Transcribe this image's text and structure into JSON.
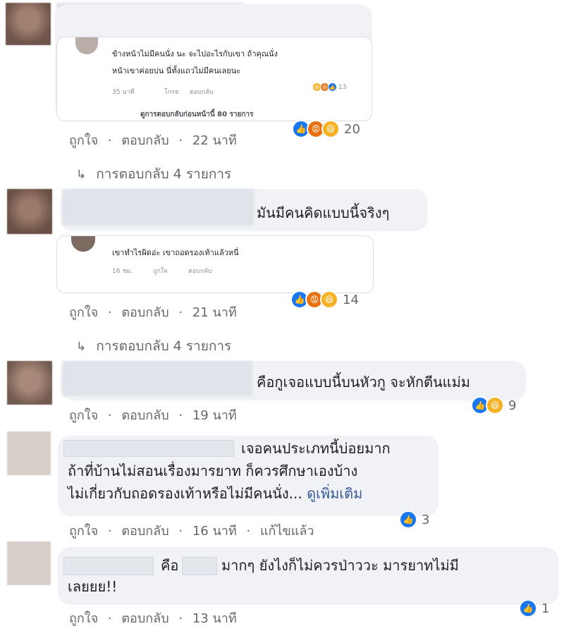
{
  "comments": [
    {
      "quoted": {
        "line1": "ข้างหน้าไม่มีคนนั่ง นะ จะไปอะไรกับเขา  ถ้าคุณนั่ง",
        "line2": "หน้าเขาค่อยบ่น นี่ทั้งแถวไม่มีคนเลยนะ",
        "meta_time": "35 นาที",
        "meta_like": "โกรธ",
        "meta_reply": "ตอบกลับ",
        "meta_count": "13",
        "more_replies": "ดูการตอบกลับก่อนหน้านี้ 80 รายการ"
      },
      "like": "ถูกใจ",
      "reply": "ตอบกลับ",
      "time": "22 นาที",
      "reaction_count": "20",
      "replies_label": "การตอบกลับ 4 รายการ"
    },
    {
      "text": "มันมีคนคิดแบบนี้จริงๆ",
      "quoted": {
        "line1": "เขาทำไรผิดอ่ะ เขาถอดรองเท้าแล้วหนี่",
        "meta_time": "16 ชม.",
        "meta_like": "ถูกใจ",
        "meta_reply": "ตอบกลับ"
      },
      "like": "ถูกใจ",
      "reply": "ตอบกลับ",
      "time": "21 นาที",
      "reaction_count": "14",
      "replies_label": "การตอบกลับ 4 รายการ"
    },
    {
      "text": "คือกูเจอแบบนี้บนหัวกู จะหักตีนแม่ม",
      "like": "ถูกใจ",
      "reply": "ตอบกลับ",
      "time": "19 นาที",
      "reaction_count": "9"
    },
    {
      "line1": "เจอคนประเภทนี้บ่อยมาก",
      "line2": "ถ้าที่บ้านไม่สอนเรื่องมารยาท ก็ควรศึกษาเองบ้าง",
      "line3": "ไม่เกี่ยวกับถอดรองเท้าหรือไม่มีคนนั่ง...",
      "see_more": "ดูเพิ่มเติม",
      "like": "ถูกใจ",
      "reply": "ตอบกลับ",
      "time": "16 นาที",
      "edited": "แก้ไขแล้ว",
      "reaction_count": "3"
    },
    {
      "word1": "คือ",
      "line1_rest": "มากๆ ยังไงก็ไม่ควรป่าววะ มารยาทไม่มี",
      "line2": "เลยยย!!",
      "like": "ถูกใจ",
      "reply": "ตอบกลับ",
      "time": "13 นาที",
      "reaction_count": "1"
    }
  ],
  "separator": "·",
  "icons": {
    "like": "like-icon",
    "angry": "angry-icon",
    "haha": "haha-icon",
    "reply_arrow": "reply-arrow-icon"
  },
  "colors": {
    "like": "#1877f2",
    "angry": "#e9710f",
    "haha": "#f7b125",
    "link": "#385898",
    "meta": "#65676b"
  }
}
